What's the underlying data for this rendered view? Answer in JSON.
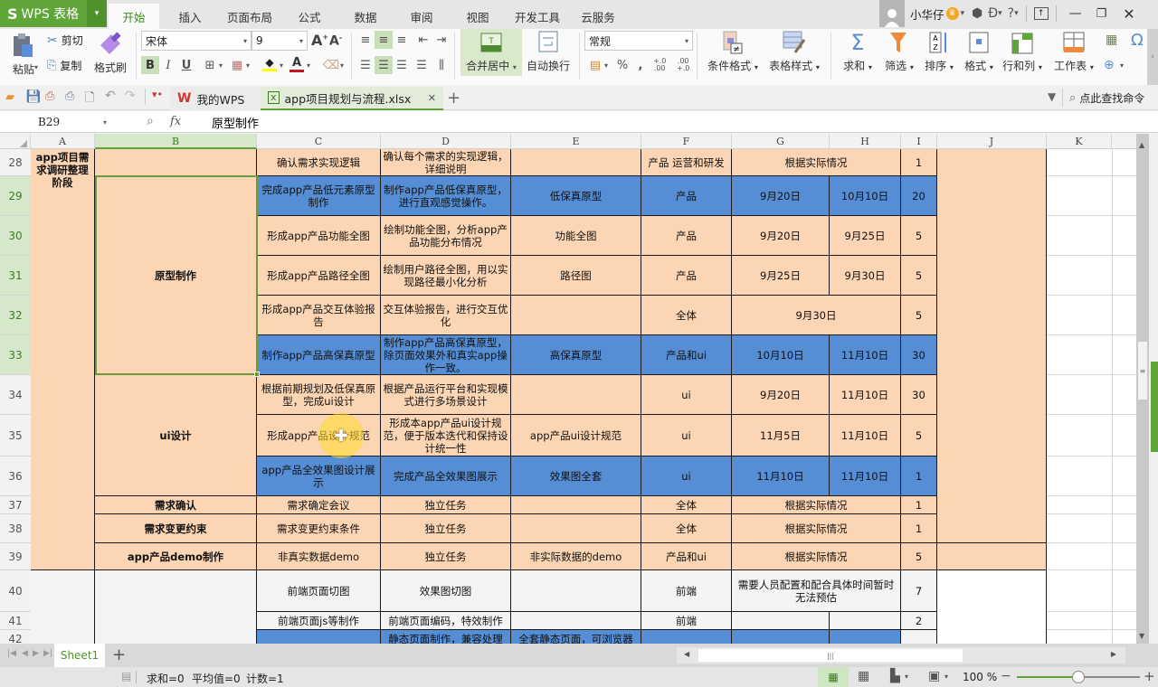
{
  "app": {
    "name": "WPS 表格",
    "brand_color": "#5fa537"
  },
  "menu_tabs": [
    {
      "label": "开始",
      "active": true
    },
    {
      "label": "插入"
    },
    {
      "label": "页面布局"
    },
    {
      "label": "公式"
    },
    {
      "label": "数据"
    },
    {
      "label": "审阅"
    },
    {
      "label": "视图"
    },
    {
      "label": "开发工具"
    },
    {
      "label": "云服务"
    }
  ],
  "user": {
    "name": "小华仔",
    "help": "?"
  },
  "ribbon": {
    "paste": "粘贴",
    "cut": "剪切",
    "copy": "复制",
    "format_painter": "格式刷",
    "font_name": "宋体",
    "font_size": "9",
    "bold": "B",
    "italic": "I",
    "underline": "U",
    "merge_center": "合并居中",
    "wrap_text": "自动换行",
    "number_format": "常规",
    "percent": "%",
    "comma": ",",
    "cond_format": "条件格式",
    "table_style": "表格样式",
    "sum": "求和",
    "filter": "筛选",
    "sort": "排序",
    "format": "格式",
    "row_col": "行和列",
    "worksheet": "工作表",
    "search_command": "点此查找命令"
  },
  "doc_tabs": [
    {
      "label": "我的WPS"
    },
    {
      "label": "app项目规划与流程.xlsx",
      "active": true
    }
  ],
  "formula_bar": {
    "cell_ref": "B29",
    "fx": "fx",
    "content": "原型制作"
  },
  "columns": [
    "A",
    "B",
    "C",
    "D",
    "E",
    "F",
    "G",
    "H",
    "I",
    "J",
    "K"
  ],
  "rows": [
    {
      "num": "28",
      "c": "确认需求实现逻辑",
      "d": "确认每个需求的实现逻辑，详细说明",
      "e": "",
      "f": "产品 运营和研发",
      "gh": "根据实际情况",
      "i": "1"
    },
    {
      "num": "29",
      "c": "完成app产品低元素原型制作",
      "d": "制作app产品低保真原型，进行直观感觉操作。",
      "e": "低保真原型",
      "f": "产品",
      "g": "9月20日",
      "h": "10月10日",
      "i": "20"
    },
    {
      "num": "30",
      "c": "形成app产品功能全图",
      "d": "绘制功能全图，分析app产品功能分布情况",
      "e": "功能全图",
      "f": "产品",
      "g": "9月20日",
      "h": "9月25日",
      "i": "5"
    },
    {
      "num": "31",
      "c": "形成app产品路径全图",
      "d": "绘制用户路径全图，用以实现路径最小化分析",
      "e": "路径图",
      "f": "产品",
      "g": "9月25日",
      "h": "9月30日",
      "i": "5"
    },
    {
      "num": "32",
      "c": "形成app产品交互体验报告",
      "d": "交互体验报告，进行交互优化",
      "e": "",
      "f": "全体",
      "gh": "9月30日",
      "i": "5"
    },
    {
      "num": "33",
      "c": "制作app产品高保真原型",
      "d": "制作app产品高保真原型，除页面效果外和真实app操作一致。",
      "e": "高保真原型",
      "f": "产品和ui",
      "g": "10月10日",
      "h": "11月10日",
      "i": "30"
    },
    {
      "num": "34",
      "c": "根据前期规划及低保真原型，完成ui设计",
      "d": "根据产品运行平台和实现模式进行多场景设计",
      "e": "",
      "f": "ui",
      "g": "9月20日",
      "h": "11月10日",
      "i": "30"
    },
    {
      "num": "35",
      "c": "形成app产品设计规范",
      "d": "形成本app产品ui设计规范，便于版本迭代和保持设计统一性",
      "e": "app产品ui设计规范",
      "f": "ui",
      "g": "11月5日",
      "h": "11月10日",
      "i": "5"
    },
    {
      "num": "36",
      "c": "app产品全效果图设计展示",
      "d": "完成产品全效果图展示",
      "e": "效果图全套",
      "f": "ui",
      "g": "11月10日",
      "h": "11月10日",
      "i": "1"
    },
    {
      "num": "37",
      "c": "需求确定会议",
      "d": "独立任务",
      "e": "",
      "f": "全体",
      "gh": "根据实际情况",
      "i": "1"
    },
    {
      "num": "38",
      "c": "需求变更约束条件",
      "d": "独立任务",
      "e": "",
      "f": "全体",
      "gh": "根据实际情况",
      "i": "1"
    },
    {
      "num": "39",
      "c": "非真实数据demo",
      "d": "独立任务",
      "e": "非实际数据的demo",
      "f": "产品和ui",
      "gh": "根据实际情况",
      "i": "5"
    },
    {
      "num": "40",
      "c": "前端页面切图",
      "d": "效果图切图",
      "e": "",
      "f": "前端",
      "gh": "需要人员配置和配合具体时间暂时无法预估",
      "i": "7"
    },
    {
      "num": "41",
      "c": "前端页面js等制作",
      "d": "前端页面编码，特效制作",
      "e": "",
      "f": "前端",
      "g": "",
      "h": "",
      "i": "2"
    },
    {
      "num": "42",
      "c": "",
      "d": "静态页面制作，兼容处理",
      "e": "全套静态页面，可浏览器",
      "f": "",
      "g": "",
      "h": "",
      "i": ""
    }
  ],
  "merged": {
    "a_phase": "app项目需求调研整理阶段",
    "b_prototype": "原型制作",
    "b_ui": "ui设计",
    "b_confirm": "需求确认",
    "b_change": "需求变更约束",
    "b_demo": "app产品demo制作"
  },
  "sheets": [
    {
      "label": "Sheet1",
      "active": true
    }
  ],
  "status": {
    "sum": "求和=0",
    "avg": "平均值=0",
    "count": "计数=1",
    "zoom": "100 %",
    "zoom_level": 100
  },
  "colors": {
    "peach": "#fcd5b4",
    "blue": "#558ed5",
    "selection": "#6a9a3a"
  }
}
